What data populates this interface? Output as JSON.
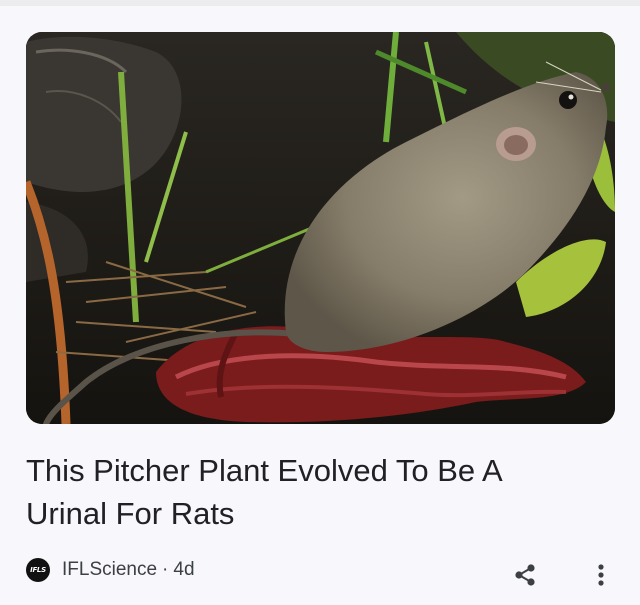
{
  "article": {
    "headline": "This Pitcher Plant Evolved To Be A Urinal For Rats",
    "image": {
      "subject": "rat-on-pitcher-plant-photo"
    }
  },
  "source": {
    "logo_text": "IFLS",
    "name": "IFLScience",
    "separator": "·",
    "age": "4d"
  },
  "icons": {
    "share": "share-icon",
    "more": "more-vertical-icon"
  },
  "colors": {
    "card_background": "#f8f7fb",
    "headline_text": "#202124",
    "meta_text": "#3c4043",
    "icon": "#3c4043"
  }
}
